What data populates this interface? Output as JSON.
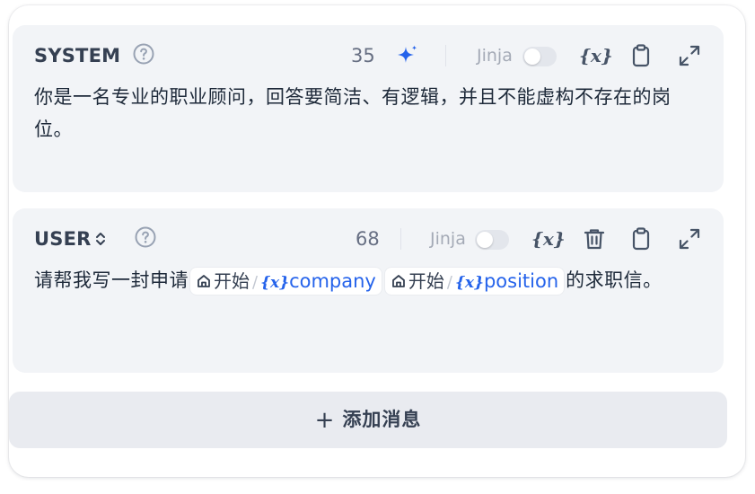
{
  "messages": [
    {
      "role": "SYSTEM",
      "token_count": "35",
      "jinja_label": "Jinja",
      "jinja_enabled": false,
      "variable_icon_label": "{x}",
      "content": "你是一名专业的职业顾问，回答要简洁、有逻辑，并且不能虚构不存在的岗位。"
    },
    {
      "role": "USER",
      "token_count": "68",
      "jinja_label": "Jinja",
      "jinja_enabled": false,
      "variable_icon_label": "{x}",
      "content_prefix": "请帮我写一封申请",
      "variables": [
        {
          "node": "开始",
          "var_icon": "{x}",
          "name": "company"
        },
        {
          "node": "开始",
          "var_icon": "{x}",
          "name": "position"
        }
      ],
      "content_suffix": "的求职信。"
    }
  ],
  "add_button": {
    "icon": "+",
    "label": "添加消息"
  },
  "colors": {
    "card_bg": "#f2f4f7",
    "accent_blue": "#2563eb",
    "text_dark": "#1d2939",
    "text_muted": "#676f83"
  },
  "icons": {
    "help": "question-circle-icon",
    "generate": "sparkle-icon",
    "variable": "variable-icon",
    "delete": "trash-icon",
    "copy": "clipboard-icon",
    "expand": "expand-icon",
    "role_switch": "chevron-up-down-icon",
    "node": "home-icon"
  }
}
